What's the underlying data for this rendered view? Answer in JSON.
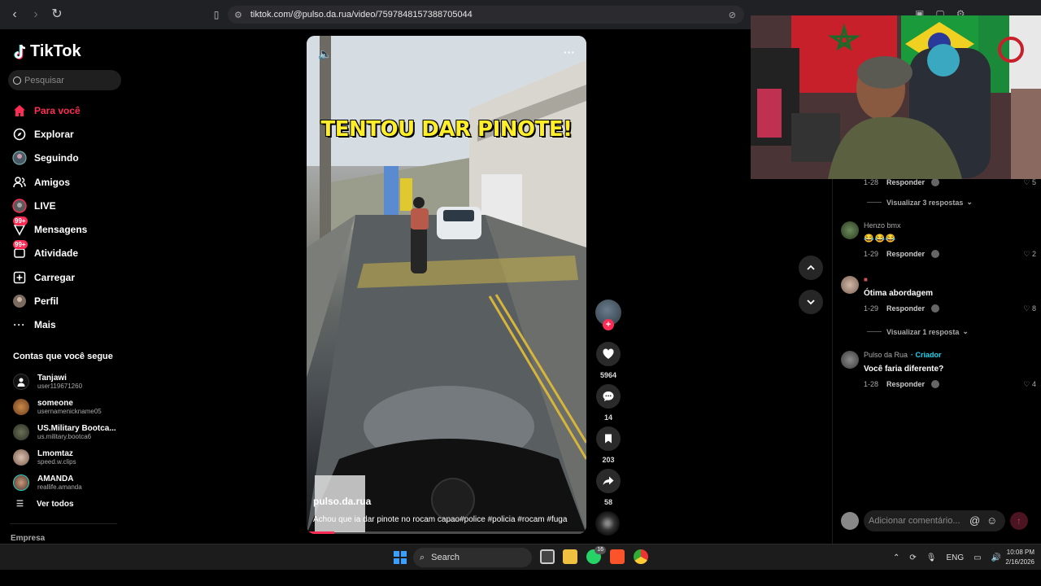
{
  "browser": {
    "url": "tiktok.com/@pulso.da.rua/video/7597848157388705044"
  },
  "sidebar": {
    "brand": "TikTok",
    "search_placeholder": "Pesquisar",
    "nav": [
      {
        "label": "Para você",
        "icon": "home-icon",
        "active": true
      },
      {
        "label": "Explorar",
        "icon": "compass-icon"
      },
      {
        "label": "Seguindo",
        "icon": "following-icon"
      },
      {
        "label": "Amigos",
        "icon": "friends-icon"
      },
      {
        "label": "LIVE",
        "icon": "live-icon"
      },
      {
        "label": "Mensagens",
        "icon": "messages-icon",
        "badge": "99+"
      },
      {
        "label": "Atividade",
        "icon": "activity-icon",
        "badge": "99+"
      },
      {
        "label": "Carregar",
        "icon": "upload-icon"
      },
      {
        "label": "Perfil",
        "icon": "profile-icon"
      },
      {
        "label": "Mais",
        "icon": "more-icon"
      }
    ],
    "following_title": "Contas que você segue",
    "following": [
      {
        "name": "Tanjawi",
        "user": "user119671260"
      },
      {
        "name": "someone",
        "user": "usernamenickname05"
      },
      {
        "name": "US.Military Bootca...",
        "user": "us.military.bootca6"
      },
      {
        "name": "Lmomtaz",
        "user": "speed.w.clips"
      },
      {
        "name": "AMANDA",
        "user": "reallife.amanda"
      }
    ],
    "see_all": "Ver todos",
    "footer": "Empresa"
  },
  "video": {
    "overlay_title": "TENTOU DAR PINOTE!",
    "author": "pulso.da.rua",
    "description": "Achou que ia dar pinote no rocam capao#police #policia #rocam #fuga",
    "progress": 0.1
  },
  "actions": {
    "likes": "5964",
    "comments": "14",
    "saves": "203",
    "shares": "58"
  },
  "comments": {
    "items": [
      {
        "user": "",
        "text": "",
        "date": "1-28",
        "reply": "Responder",
        "likes": "5",
        "view_replies": "Visualizar 3 respostas"
      },
      {
        "user": "Henzo bmx",
        "emojis": "😂😂😂",
        "date": "1-29",
        "reply": "Responder",
        "likes": "2"
      },
      {
        "user": "",
        "text": "Ótima abordagem",
        "date": "1-29",
        "reply": "Responder",
        "likes": "8",
        "view_replies": "Visualizar 1 resposta"
      },
      {
        "user": "Pulso da Rua",
        "creator": "· Criador",
        "text": "Você faria diferente?",
        "date": "1-28",
        "reply": "Responder",
        "likes": "4"
      }
    ],
    "input_placeholder": "Adicionar comentário..."
  },
  "taskbar": {
    "search": "Search",
    "whatsapp_badge": "16",
    "lang": "ENG",
    "time": "10:08 PM",
    "date": "2/16/2026"
  }
}
